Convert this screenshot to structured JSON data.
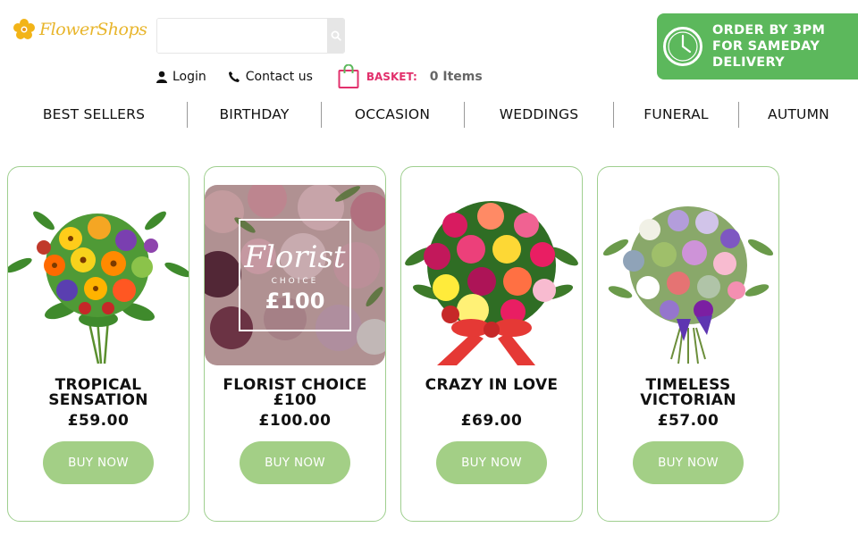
{
  "logo": {
    "text": "FlowerShops"
  },
  "search": {
    "placeholder": "",
    "value": "",
    "icon": "search-icon"
  },
  "account": {
    "login_label": "Login",
    "contact_label": "Contact us",
    "basket_label": "BASKET:",
    "basket_count": "0 Items"
  },
  "delivery": {
    "line1": "ORDER BY 3PM",
    "line2": "FOR SAMEDAY",
    "line3": "DELIVERY",
    "icon": "clock-icon"
  },
  "nav": {
    "items": [
      {
        "label": "BEST SELLERS"
      },
      {
        "label": "BIRTHDAY"
      },
      {
        "label": "OCCASION"
      },
      {
        "label": "WEDDINGS"
      },
      {
        "label": "FUNERAL"
      },
      {
        "label": "AUTUMN"
      }
    ]
  },
  "products": [
    {
      "name_line1": "TROPICAL",
      "name_line2": "SENSATION",
      "price": "£59.00",
      "button": "BUY NOW"
    },
    {
      "name_line1": "FLORIST CHOICE",
      "name_line2": "£100",
      "price": "£100.00",
      "button": "BUY NOW",
      "image_text": {
        "script": "Florist",
        "sub": "CHOICE",
        "amount": "£100"
      }
    },
    {
      "name_line1": "CRAZY IN LOVE",
      "name_line2": "",
      "price": "£69.00",
      "button": "BUY NOW"
    },
    {
      "name_line1": "TIMELESS",
      "name_line2": "VICTORIAN",
      "price": "£57.00",
      "button": "BUY NOW"
    }
  ],
  "colors": {
    "brand_green": "#5cb85c",
    "button_green": "#a3cf86",
    "card_border": "#9fcf8f",
    "basket_pink": "#e2306c",
    "logo_gold": "#e8b52b"
  }
}
